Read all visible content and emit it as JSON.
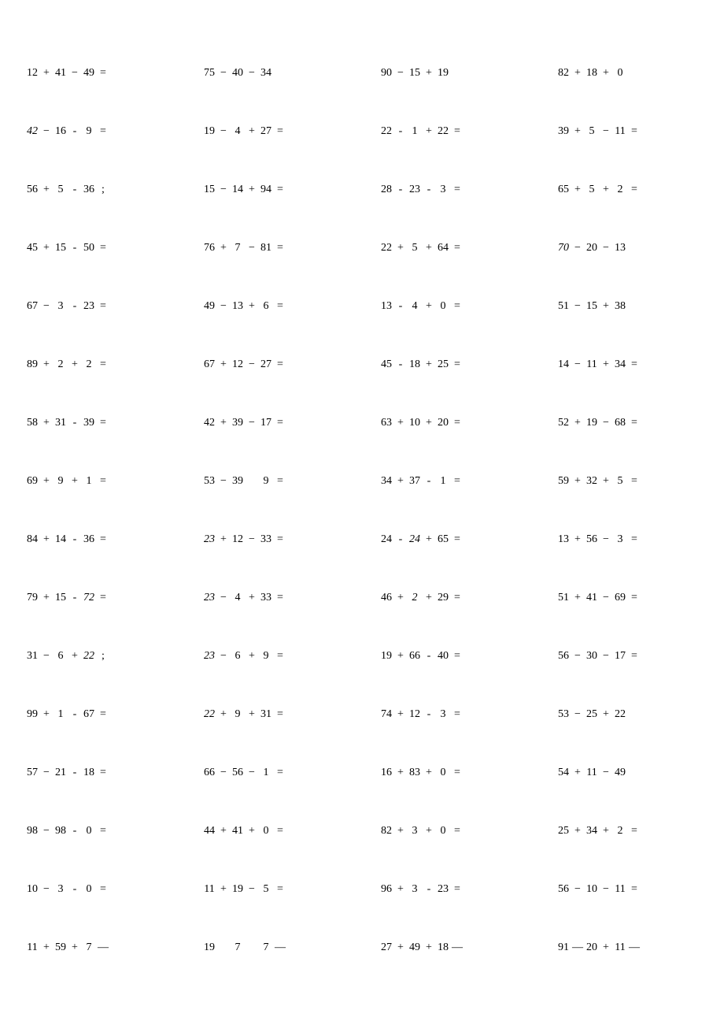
{
  "problems": [
    {
      "a": "12",
      "op1": "+",
      "b": "41",
      "op2": "−",
      "c": "49",
      "eq": "="
    },
    {
      "a": "75",
      "op1": "−",
      "b": "40",
      "op2": "−",
      "c": "34",
      "eq": ""
    },
    {
      "a": "90",
      "op1": "−",
      "b": "15",
      "op2": "+",
      "c": "19",
      "eq": ""
    },
    {
      "a": "82",
      "op1": "+",
      "b": "18",
      "op2": "+",
      "c": "0",
      "eq": ""
    },
    {
      "a": "42",
      "a_it": true,
      "op1": "−",
      "b": "16",
      "op2": "-",
      "c": "9",
      "eq": "="
    },
    {
      "a": "19",
      "op1": "−",
      "b": "4",
      "op2": "+",
      "c": "27",
      "eq": "="
    },
    {
      "a": "22",
      "op1": "-",
      "b": "1",
      "op2": "+",
      "c": "22",
      "eq": "="
    },
    {
      "a": "39",
      "op1": "+",
      "b": "5",
      "op2": "−",
      "c": "11",
      "eq": "="
    },
    {
      "a": "56",
      "op1": "+",
      "b": "5",
      "op2": "-",
      "c": "36",
      "eq": ";"
    },
    {
      "a": "15",
      "op1": "−",
      "b": "14",
      "op2": "+",
      "c": "94",
      "eq": "="
    },
    {
      "a": "28",
      "op1": "-",
      "b": "23",
      "op2": "-",
      "c": "3",
      "eq": "="
    },
    {
      "a": "65",
      "op1": "+",
      "b": "5",
      "op2": "+",
      "c": "2",
      "eq": "="
    },
    {
      "a": "45",
      "op1": "+",
      "b": "15",
      "op2": "-",
      "c": "50",
      "eq": "="
    },
    {
      "a": "76",
      "op1": "+",
      "b": "7",
      "op2": "−",
      "c": "81",
      "eq": "="
    },
    {
      "a": "22",
      "op1": "+",
      "b": "5",
      "op2": "+",
      "c": "64",
      "eq": "="
    },
    {
      "a": "70",
      "a_it": true,
      "op1": "−",
      "b": "20",
      "op2": "−",
      "c": "13",
      "eq": ""
    },
    {
      "a": "67",
      "op1": "−",
      "b": "3",
      "op2": "-",
      "c": "23",
      "eq": "="
    },
    {
      "a": "49",
      "op1": "−",
      "b": "13",
      "op2": "+",
      "c": "6",
      "eq": "="
    },
    {
      "a": "13",
      "op1": "-",
      "b": "4",
      "op2": "+",
      "c": "0",
      "eq": "="
    },
    {
      "a": "51",
      "op1": "−",
      "b": "15",
      "op2": "+",
      "c": "38",
      "eq": ""
    },
    {
      "a": "89",
      "op1": "+",
      "b": "2",
      "op2": "+",
      "c": "2",
      "eq": "="
    },
    {
      "a": "67",
      "op1": "+",
      "b": "12",
      "op2": "−",
      "c": "27",
      "eq": "="
    },
    {
      "a": "45",
      "op1": "-",
      "b": "18",
      "op2": "+",
      "c": "25",
      "eq": "="
    },
    {
      "a": "14",
      "op1": "−",
      "b": "11",
      "op2": "+",
      "c": "34",
      "eq": "="
    },
    {
      "a": "58",
      "op1": "+",
      "b": "31",
      "op2": "-",
      "c": "39",
      "eq": "="
    },
    {
      "a": "42",
      "op1": "+",
      "b": "39",
      "op2": "−",
      "c": "17",
      "eq": "="
    },
    {
      "a": "63",
      "op1": "+",
      "b": "10",
      "op2": "+",
      "c": "20",
      "eq": "="
    },
    {
      "a": "52",
      "op1": "+",
      "b": "19",
      "op2": "−",
      "c": "68",
      "eq": "="
    },
    {
      "a": "69",
      "op1": "+",
      "b": "9",
      "op2": "+",
      "c": "1",
      "eq": "="
    },
    {
      "a": "53",
      "op1": "−",
      "b": "39",
      "op2": "",
      "c": "9",
      "eq": "="
    },
    {
      "a": "34",
      "op1": "+",
      "b": "37",
      "op2": "-",
      "c": "1",
      "eq": "="
    },
    {
      "a": "59",
      "op1": "+",
      "b": "32",
      "op2": "+",
      "c": "5",
      "eq": "="
    },
    {
      "a": "84",
      "op1": "+",
      "b": "14",
      "op2": "-",
      "c": "36",
      "eq": "="
    },
    {
      "a": "23",
      "a_it": true,
      "op1": "+",
      "b": "12",
      "op2": "−",
      "c": "33",
      "eq": "="
    },
    {
      "a": "24",
      "op1": "-",
      "b": "24",
      "b_it": true,
      "op2": "+",
      "c": "65",
      "eq": "="
    },
    {
      "a": "13",
      "op1": "+",
      "b": "56",
      "op2": "−",
      "c": "3",
      "eq": "="
    },
    {
      "a": "79",
      "op1": "+",
      "b": "15",
      "op2": "-",
      "c": "72",
      "c_it": true,
      "eq": "="
    },
    {
      "a": "23",
      "a_it": true,
      "op1": "−",
      "b": "4",
      "op2": "+",
      "c": "33",
      "eq": "="
    },
    {
      "a": "46",
      "op1": "+",
      "b": "2",
      "b_it": true,
      "op2": "+",
      "c": "29",
      "eq": "="
    },
    {
      "a": "51",
      "op1": "+",
      "b": "41",
      "op2": "−",
      "c": "69",
      "eq": "="
    },
    {
      "a": "31",
      "op1": "−",
      "b": "6",
      "op2": "+",
      "c": "22",
      "c_it": true,
      "eq": ";"
    },
    {
      "a": "23",
      "a_it": true,
      "op1": "−",
      "b": "6",
      "op2": "+",
      "c": "9",
      "eq": "="
    },
    {
      "a": "19",
      "op1": "+",
      "b": "66",
      "op2": "-",
      "c": "40",
      "eq": "="
    },
    {
      "a": "56",
      "op1": "−",
      "b": "30",
      "op2": "−",
      "c": "17",
      "eq": "="
    },
    {
      "a": "99",
      "op1": "+",
      "b": "1",
      "op2": "-",
      "c": "67",
      "eq": "="
    },
    {
      "a": "22",
      "a_it": true,
      "op1": "+",
      "b": "9",
      "op2": "+",
      "c": "31",
      "eq": "="
    },
    {
      "a": "74",
      "op1": "+",
      "b": "12",
      "op2": "-",
      "c": "3",
      "eq": "="
    },
    {
      "a": "53",
      "op1": "−",
      "b": "25",
      "op2": "+",
      "c": "22",
      "eq": ""
    },
    {
      "a": "57",
      "op1": "−",
      "b": "21",
      "op2": "-",
      "c": "18",
      "eq": "="
    },
    {
      "a": "66",
      "op1": "−",
      "b": "56",
      "op2": "−",
      "c": "1",
      "eq": "="
    },
    {
      "a": "16",
      "op1": "+",
      "b": "83",
      "op2": "+",
      "c": "0",
      "eq": "="
    },
    {
      "a": "54",
      "op1": "+",
      "b": "11",
      "op2": "−",
      "c": "49",
      "eq": ""
    },
    {
      "a": "98",
      "op1": "−",
      "b": "98",
      "op2": "-",
      "c": "0",
      "eq": "="
    },
    {
      "a": "44",
      "op1": "+",
      "b": "41",
      "op2": "+",
      "c": "0",
      "eq": "="
    },
    {
      "a": "82",
      "op1": "+",
      "b": "3",
      "op2": "+",
      "c": "0",
      "eq": "="
    },
    {
      "a": "25",
      "op1": "+",
      "b": "34",
      "op2": "+",
      "c": "2",
      "eq": "="
    },
    {
      "a": "10",
      "op1": "−",
      "b": "3",
      "op2": "-",
      "c": "0",
      "eq": "="
    },
    {
      "a": "11",
      "op1": "+",
      "b": "19",
      "op2": "−",
      "c": "5",
      "eq": "="
    },
    {
      "a": "96",
      "op1": "+",
      "b": "3",
      "op2": "-",
      "c": "23",
      "eq": "="
    },
    {
      "a": "56",
      "op1": "−",
      "b": "10",
      "op2": "−",
      "c": "11",
      "eq": "="
    },
    {
      "a": "11",
      "op1": "+",
      "b": "59",
      "op2": "+",
      "c": "7",
      "eq": "—"
    },
    {
      "a": "19",
      "op1": "",
      "b": "7",
      "op2": "",
      "c": "7",
      "eq": "—"
    },
    {
      "a": "27",
      "op1": "+",
      "b": "49",
      "op2": "+",
      "c": "18",
      "eq": "—"
    },
    {
      "a": "91",
      "op1": "—",
      "b": "20",
      "op2": "+",
      "c": "11",
      "eq": "—"
    }
  ]
}
